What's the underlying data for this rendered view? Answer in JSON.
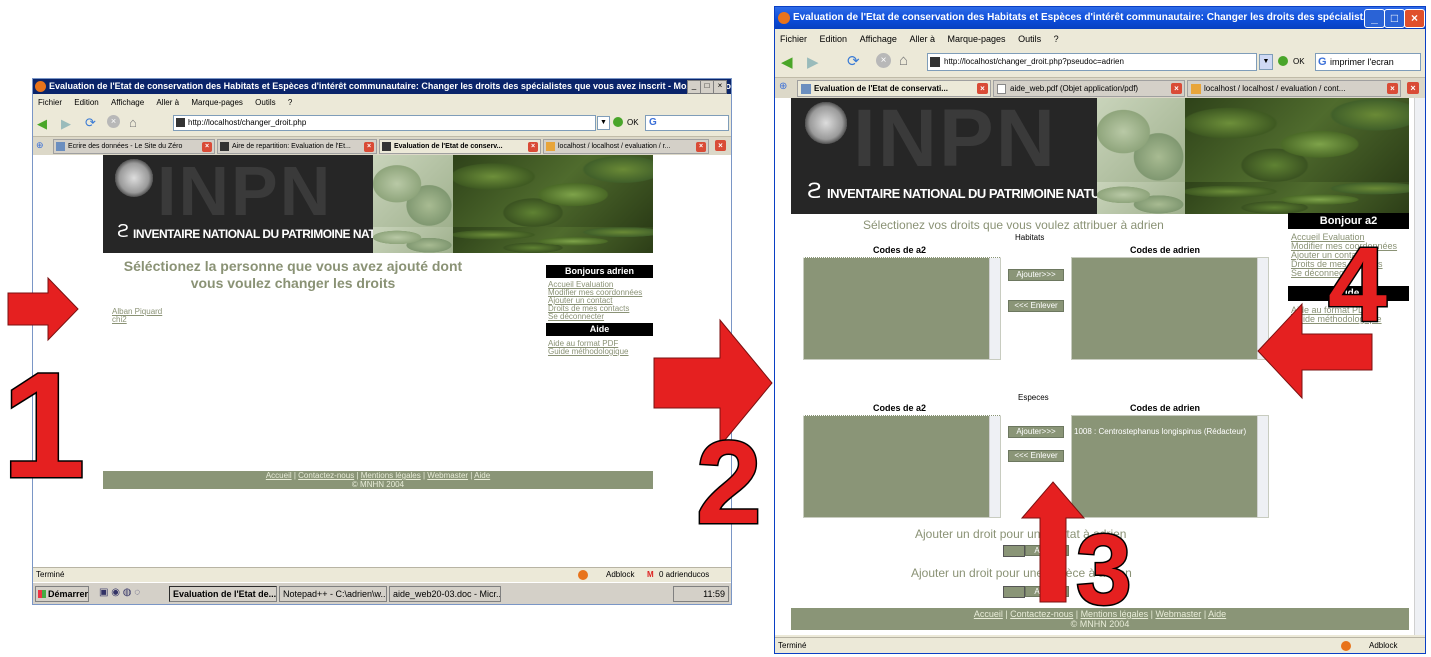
{
  "left": {
    "title": "Evaluation de l'Etat de conservation des Habitats et Espèces d'intérêt communautaire: Changer les droits des spécialistes que vous avez inscrit - Mozilla Firefox",
    "menu": [
      "Fichier",
      "Edition",
      "Affichage",
      "Aller à",
      "Marque-pages",
      "Outils",
      "?"
    ],
    "url": "http://localhost/changer_droit.php",
    "ok_label": "OK",
    "search_letter": "G",
    "tabs": [
      "Ecrire des données - Le Site du Zéro",
      "Aire de repartition: Evaluation de l'Et...",
      "Evaluation de l'Etat de conserv...",
      "localhost / localhost / evaluation / r..."
    ],
    "tagline": "INVENTAIRE NATIONAL DU PATRIMOINE NATUREL",
    "logo": "INPN",
    "heading": "Séléctionez la personne que vous avez ajouté dont vous voulez changer les droits",
    "people": [
      "Alban  Piquard",
      "chi2"
    ],
    "sidebar_title": "Bonjours adrien",
    "sidebar_links": [
      "Accueil Evaluation",
      "Modifier mes coordonnées",
      "Ajouter un contact",
      "Droits de mes contacts",
      "Se déconnecter"
    ],
    "help_title": "Aide",
    "help_links": [
      "Aide au format PDF",
      "Guide méthodologique"
    ],
    "footer_links": [
      "Accueil",
      "Contactez-nous",
      "Mentions légales",
      "Webmaster",
      "Aide"
    ],
    "footer_copy": "© MNHN 2004",
    "status": "Terminé",
    "adblock": "Adblock",
    "mail": "0 adrienducos",
    "taskbar": {
      "start": "Démarrer",
      "items": [
        "Evaluation de l'Etat de...",
        "Notepad++ - C:\\adrien\\w...",
        "aide_web20-03.doc - Micr..."
      ],
      "clock": "11:59"
    }
  },
  "right": {
    "title": "Evaluation de l'Etat de conservation des Habitats et Espèces d'intérêt communautaire: Changer les droits des spécialist...",
    "menu": [
      "Fichier",
      "Edition",
      "Affichage",
      "Aller à",
      "Marque-pages",
      "Outils",
      "?"
    ],
    "url": "http://localhost/changer_droit.php?pseudoc=adrien",
    "ok_label": "OK",
    "search_text": "imprimer l'ecran",
    "tabs": [
      "Evaluation de l'Etat de conservati...",
      "aide_web.pdf (Objet application/pdf)",
      "localhost / localhost / evaluation  / cont..."
    ],
    "tagline": "INVENTAIRE NATIONAL DU PATRIMOINE NATUREL",
    "logo": "INPN",
    "heading": "Sélectionez vos droits que vous voulez attribuer à adrien",
    "habitats_label": "Habitats",
    "especes_label": "Especes",
    "codes_a2": "Codes de a2",
    "codes_adrien": "Codes de adrien",
    "add_btn": "Ajouter>>>",
    "remove_btn": "<<< Enlever",
    "espece_item": "1008 : Centrostephanus longispinus (Rédacteur)",
    "sidebar_title": "Bonjour a2",
    "sidebar_links": [
      "Accueil Evaluation",
      "Modifier mes coordonnées",
      "Ajouter un contact",
      "Droits de mes contacts",
      "Se déconnecter"
    ],
    "help_title": "Aide",
    "help_links": [
      "Aide au format PDF",
      "Guide méthodologique"
    ],
    "add_habitat": "Ajouter un droit pour un habitat à adrien",
    "add_espece": "Ajouter un droit pour une espèce à adrien",
    "ajouter": "Ajouter",
    "footer_links": [
      "Accueil",
      "Contactez-nous",
      "Mentions légales",
      "Webmaster",
      "Aide"
    ],
    "footer_copy": "© MNHN 2004",
    "status": "Terminé",
    "adblock": "Adblock"
  },
  "annotations": {
    "n1": "1",
    "n2": "2",
    "n3": "3",
    "n4": "4",
    "arrow_color": "#e52020"
  }
}
